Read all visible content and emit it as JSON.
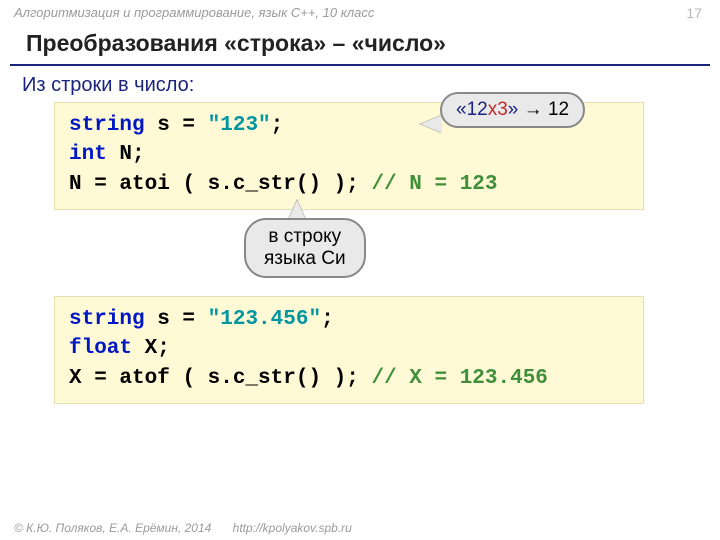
{
  "header": {
    "breadcrumb": "Алгоритмизация и программирование, язык C++, 10 класс",
    "page_number": "17"
  },
  "title": "Преобразования «строка» – «число»",
  "subtitle": "Из строки в число:",
  "callouts": {
    "top_prefix": "«",
    "top_good": "12",
    "top_bad": "х3",
    "top_suffix": "»",
    "top_arrow": " → ",
    "top_result": "12",
    "mid_line1": "в строку",
    "mid_line2": "языка Си"
  },
  "code1": {
    "l1_kw": "string",
    "l1_rest": " s = ",
    "l1_str": "\"123\"",
    "l1_semi": ";",
    "l2_kw": "int",
    "l2_rest": " N;",
    "l3_a": "N = ",
    "l3_fn": "atoi",
    "l3_b": " ( s.c_str() );",
    "l3_cmt": "   // N = 123"
  },
  "code2": {
    "l1_kw": "string",
    "l1_rest": " s = ",
    "l1_str": "\"123.456\"",
    "l1_semi": ";",
    "l2_kw": "float",
    "l2_rest": " X;",
    "l3_a": "X = ",
    "l3_fn": "atof",
    "l3_b": " ( s.c_str() );",
    "l3_cmt": "  // X = 123.456"
  },
  "footer": {
    "copyright": "© К.Ю. Поляков, Е.А. Ерёмин, 2014",
    "url": "http://kpolyakov.spb.ru"
  }
}
